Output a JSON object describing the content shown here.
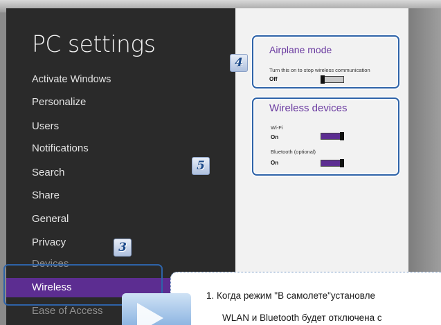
{
  "page_title": "PC settings",
  "nav_items": [
    {
      "label": "Activate Windows"
    },
    {
      "label": "Personalize"
    },
    {
      "label": "Users"
    },
    {
      "label": "Notifications"
    },
    {
      "label": "Search"
    },
    {
      "label": "Share"
    },
    {
      "label": "General"
    },
    {
      "label": "Privacy"
    },
    {
      "label": "Devices"
    },
    {
      "label": "Wireless"
    },
    {
      "label": "Ease of Access"
    }
  ],
  "selected_nav": "Wireless",
  "airplane": {
    "title": "Airplane mode",
    "description": "Turn this on to stop wireless communication",
    "state": "Off"
  },
  "wireless_devices": {
    "title": "Wireless devices",
    "wifi_label": "Wi-Fi",
    "wifi_state": "On",
    "bluetooth_label": "Bluetooth (optional)",
    "bluetooth_state": "On"
  },
  "callouts": {
    "three": "3",
    "four": "4",
    "five": "5"
  },
  "note": {
    "line1": "1.  Когда режим \"В самолете\"установле",
    "line2": "WLAN и Bluetooth будет отключена с"
  },
  "colors": {
    "accent": "#5c2d91",
    "callout_border": "#2e63a8",
    "sidebar_bg": "#2a2a2a",
    "content_bg": "#f2f2f2"
  }
}
